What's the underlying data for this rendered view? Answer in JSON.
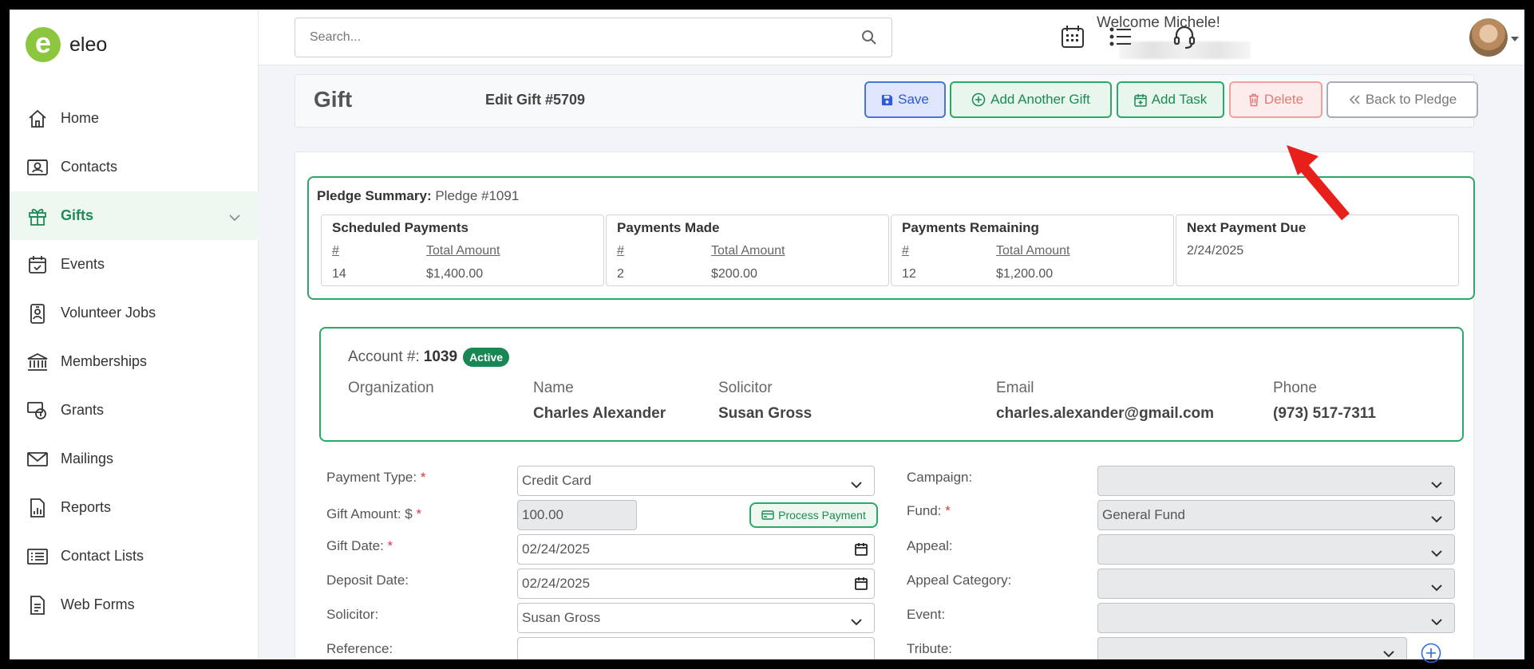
{
  "app": {
    "logo_letter": "e",
    "logo_text": "eleo"
  },
  "sidebar": {
    "items": [
      {
        "label": "Home",
        "icon": "home-icon"
      },
      {
        "label": "Contacts",
        "icon": "contact-card-icon"
      },
      {
        "label": "Gifts",
        "icon": "gift-icon",
        "active": true
      },
      {
        "label": "Events",
        "icon": "calendar-check-icon"
      },
      {
        "label": "Volunteer Jobs",
        "icon": "id-badge-icon"
      },
      {
        "label": "Memberships",
        "icon": "bank-icon"
      },
      {
        "label": "Grants",
        "icon": "money-icon"
      },
      {
        "label": "Mailings",
        "icon": "envelope-icon"
      },
      {
        "label": "Reports",
        "icon": "report-icon"
      },
      {
        "label": "Contact Lists",
        "icon": "list-icon"
      },
      {
        "label": "Web Forms",
        "icon": "form-icon"
      }
    ]
  },
  "topbar": {
    "search_placeholder": "Search...",
    "welcome": "Welcome Michele!"
  },
  "header": {
    "title": "Gift",
    "subtitle": "Edit Gift #5709",
    "buttons": {
      "save": "Save",
      "add_gift": "Add Another Gift",
      "add_task": "Add Task",
      "delete": "Delete",
      "back": "Back to Pledge"
    }
  },
  "pledge": {
    "label": "Pledge Summary:",
    "value": "Pledge #1091",
    "boxes": [
      {
        "heading": "Scheduled Payments",
        "col1": "#",
        "col2": "Total Amount",
        "count": "14",
        "amount": "$1,400.00"
      },
      {
        "heading": "Payments Made",
        "col1": "#",
        "col2": "Total Amount",
        "count": "2",
        "amount": "$200.00"
      },
      {
        "heading": "Payments Remaining",
        "col1": "#",
        "col2": "Total Amount",
        "count": "12",
        "amount": "$1,200.00"
      }
    ],
    "next": {
      "heading": "Next Payment Due",
      "value": "2/24/2025"
    }
  },
  "account": {
    "label": "Account #:",
    "number": "1039",
    "status": "Active",
    "organization_label": "Organization",
    "name_label": "Name",
    "name": "Charles Alexander",
    "solicitor_label": "Solicitor",
    "solicitor": "Susan Gross",
    "email_label": "Email",
    "email": "charles.alexander@gmail.com",
    "phone_label": "Phone",
    "phone": "(973) 517-7311"
  },
  "form": {
    "payment_type_label": "Payment Type:",
    "payment_type": "Credit Card",
    "gift_amount_label": "Gift Amount: $",
    "gift_amount": "100.00",
    "process_payment": "Process Payment",
    "gift_date_label": "Gift Date:",
    "gift_date": "02/24/2025",
    "deposit_date_label": "Deposit Date:",
    "deposit_date": "02/24/2025",
    "solicitor_label": "Solicitor:",
    "solicitor": "Susan Gross",
    "reference_label": "Reference:",
    "reference": "",
    "campaign_label": "Campaign:",
    "campaign": "",
    "fund_label": "Fund:",
    "fund": "General Fund",
    "appeal_label": "Appeal:",
    "appeal": "",
    "appeal_category_label": "Appeal Category:",
    "appeal_category": "",
    "event_label": "Event:",
    "event": "",
    "tribute_label": "Tribute:",
    "tribute": "",
    "required_mark": "*"
  },
  "colors": {
    "brand_green": "#2aa866",
    "primary_blue": "#4b74d8",
    "danger": "#dc3545",
    "annotation_arrow": "#e8201c"
  }
}
